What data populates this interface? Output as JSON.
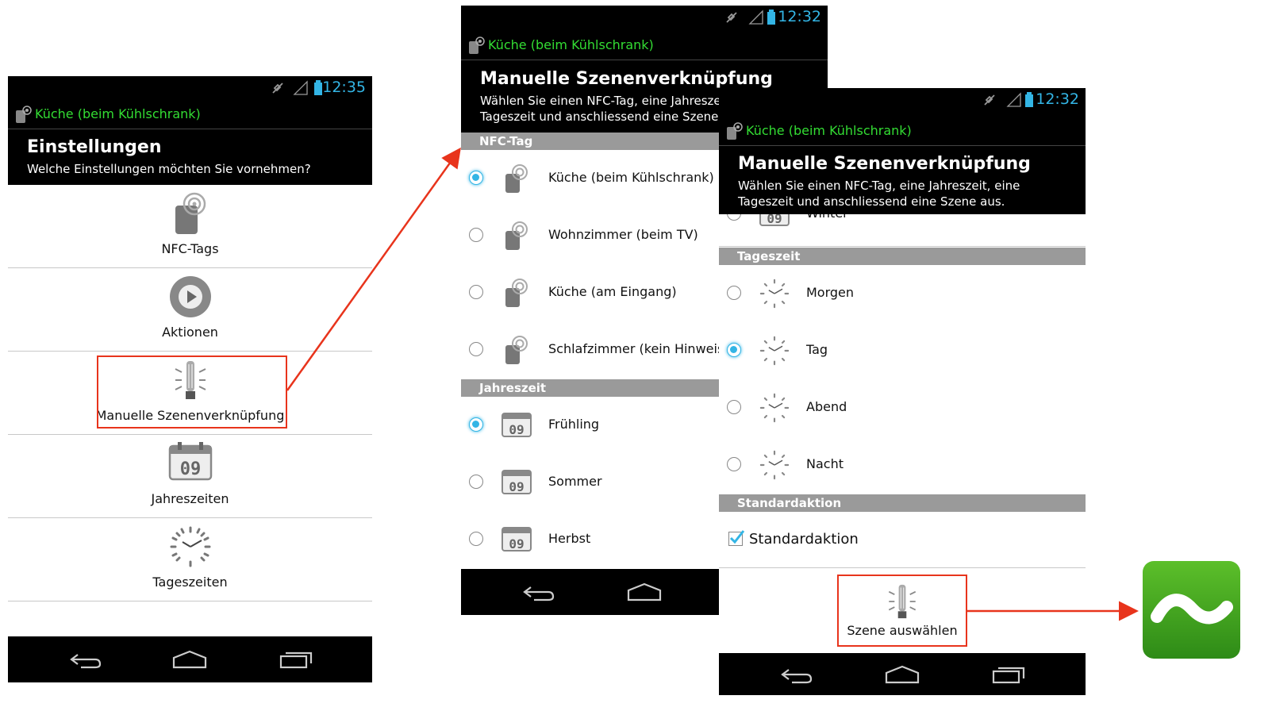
{
  "screen1": {
    "time": "12:35",
    "app_name": "Küche (beim Kühlschrank)",
    "title": "Einstellungen",
    "subtitle": "Welche Einstellungen möchten Sie vornehmen?",
    "items": [
      {
        "label": "NFC-Tags",
        "icon": "nfc-tag-icon"
      },
      {
        "label": "Aktionen",
        "icon": "play-icon"
      },
      {
        "label": "Manuelle Szenenverknüpfung",
        "icon": "bulb-icon"
      },
      {
        "label": "Jahreszeiten",
        "icon": "calendar-icon"
      },
      {
        "label": "Tageszeiten",
        "icon": "clock-icon"
      }
    ]
  },
  "screen2": {
    "time": "12:32",
    "app_name": "Küche (beim Kühlschrank)",
    "title": "Manuelle Szenenverknüpfung",
    "subtitle_line1": "Wählen Sie einen NFC-Tag, eine Jahreszeit, eine",
    "subtitle_line2": "Tageszeit und anschliessend eine Szene aus.",
    "section_nfc": "NFC-Tag",
    "nfc_tags": [
      {
        "label": "Küche (beim Kühlschrank)",
        "selected": true
      },
      {
        "label": "Wohnzimmer (beim TV)",
        "selected": false
      },
      {
        "label": "Küche (am Eingang)",
        "selected": false
      },
      {
        "label": "Schlafzimmer (kein Hinweis)",
        "selected": false
      }
    ],
    "section_season": "Jahreszeit",
    "seasons": [
      {
        "label": "Frühling",
        "selected": true
      },
      {
        "label": "Sommer",
        "selected": false
      },
      {
        "label": "Herbst",
        "selected": false
      }
    ]
  },
  "screen3": {
    "time": "12:32",
    "app_name": "Küche (beim Kühlschrank)",
    "title": "Manuelle Szenenverknüpfung",
    "subtitle_line1": "Wählen Sie einen NFC-Tag, eine Jahreszeit, eine",
    "subtitle_line2": "Tageszeit und anschliessend eine Szene aus.",
    "season_partial": "Winter",
    "section_daytime": "Tageszeit",
    "daytimes": [
      {
        "label": "Morgen",
        "selected": false
      },
      {
        "label": "Tag",
        "selected": true
      },
      {
        "label": "Abend",
        "selected": false
      },
      {
        "label": "Nacht",
        "selected": false
      }
    ],
    "section_default": "Standardaktion",
    "default_checkbox_label": "Standardaktion",
    "default_checked": true,
    "scene_button": "Szene auswählen"
  },
  "colors": {
    "accent": "#33b5e5",
    "app_name": "#33dd33",
    "highlight": "#e8341c",
    "logo_green": "#3a9a1e"
  }
}
